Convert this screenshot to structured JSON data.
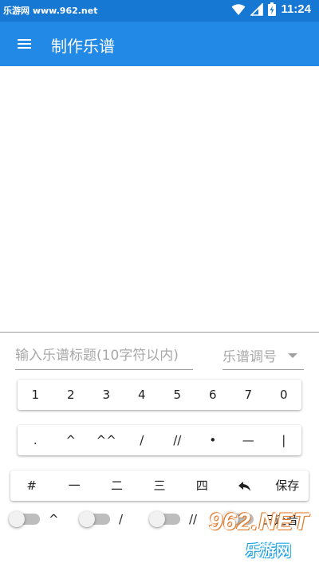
{
  "status_bar": {
    "watermark": "乐游网 www.962.net",
    "time": "11:24"
  },
  "app_bar": {
    "title": "制作乐谱"
  },
  "form": {
    "title_placeholder": "输入乐谱标题(10字符以内)",
    "key_select_label": "乐谱调号"
  },
  "keyboard": {
    "digits": [
      "1",
      "2",
      "3",
      "4",
      "5",
      "6",
      "7",
      "0"
    ],
    "marks": [
      ".",
      "^",
      "^^",
      "/",
      "//",
      "•",
      "—",
      "|"
    ],
    "special": [
      "#",
      "一",
      "二",
      "三",
      "四",
      "↩",
      "保存"
    ]
  },
  "toggles": [
    {
      "label": "^",
      "on": false
    },
    {
      "label": "/",
      "on": false
    },
    {
      "label": "//",
      "on": false
    },
    {
      "label": "三连音",
      "on": false
    }
  ],
  "watermark_logo": {
    "main": "962.NET",
    "sub": "乐游网"
  },
  "colors": {
    "status_bar": "#1778d4",
    "app_bar": "#2389e6"
  }
}
